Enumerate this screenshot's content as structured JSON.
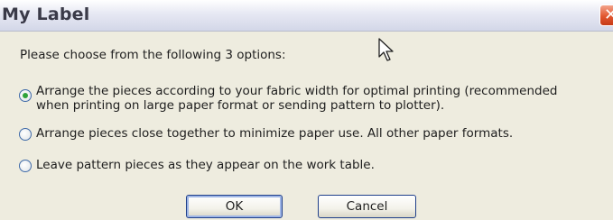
{
  "dialog": {
    "title": "My Label",
    "close_glyph": "✕",
    "prompt": "Please choose from the following 3 options:",
    "options": [
      {
        "line1": "Arrange the pieces according to your fabric width for optimal printing (recommended",
        "line2": "when printing on large paper format or sending pattern to plotter).",
        "selected": true
      },
      {
        "line1": "Arrange pieces close together to minimize paper use.  All other paper formats.",
        "selected": false
      },
      {
        "line1": "Leave pattern pieces as they appear on the work table.",
        "selected": false
      }
    ],
    "ok_label": "OK",
    "cancel_label": "Cancel"
  },
  "colors": {
    "radio_selected": "#2fa33a",
    "close_button": "#e2572f",
    "button_border": "#1f3f8a"
  },
  "icons": {
    "cursor": "mouse-pointer-icon",
    "close": "close-icon"
  }
}
